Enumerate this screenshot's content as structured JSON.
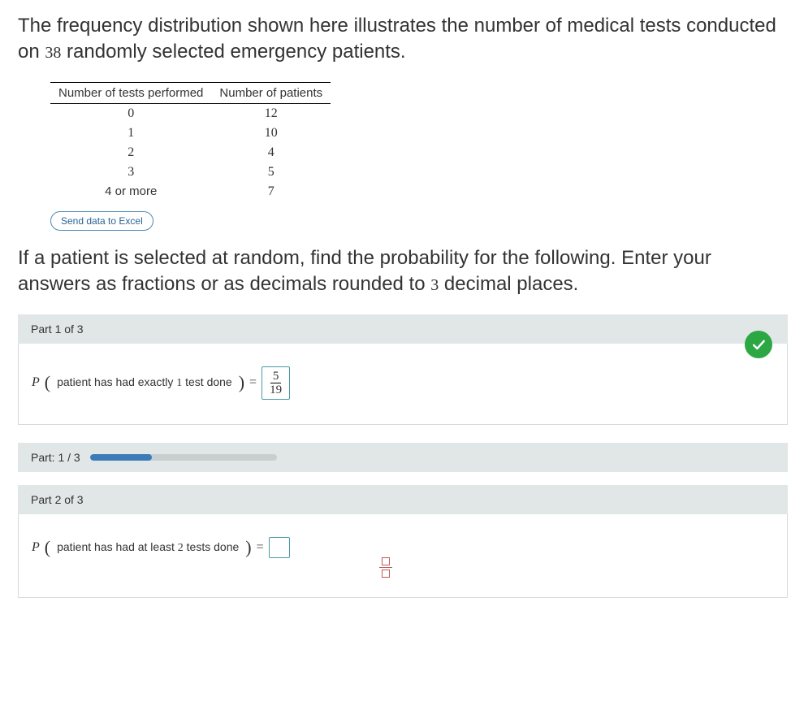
{
  "intro": {
    "line1a": "The frequency distribution shown here illustrates the number of medical tests conducted on ",
    "sample_size": "38",
    "line1b": " randomly selected emergency patients."
  },
  "table": {
    "headers": [
      "Number of tests performed",
      "Number of patients"
    ],
    "rows": [
      {
        "tests": "0",
        "patients": "12"
      },
      {
        "tests": "1",
        "patients": "10"
      },
      {
        "tests": "2",
        "patients": "4"
      },
      {
        "tests": "3",
        "patients": "5"
      },
      {
        "tests": "4 or more",
        "patients": "7"
      }
    ]
  },
  "excel_button": "Send data to Excel",
  "prompt": {
    "a": "If a patient is selected at random, find the probability for the following. Enter your answers as fractions or as decimals rounded to ",
    "places": "3",
    "b": " decimal places."
  },
  "part1": {
    "header": "Part 1 of 3",
    "p_symbol": "P",
    "text_a": "patient has had exactly ",
    "num_tests": "1",
    "text_b": " test done",
    "equals": "=",
    "answer_num": "5",
    "answer_den": "19"
  },
  "progress": {
    "label": "Part: 1 / 3",
    "percent": 33
  },
  "part2": {
    "header": "Part 2 of 3",
    "p_symbol": "P",
    "text_a": "patient has had at least ",
    "num_tests": "2",
    "text_b": " tests done",
    "equals": "="
  }
}
